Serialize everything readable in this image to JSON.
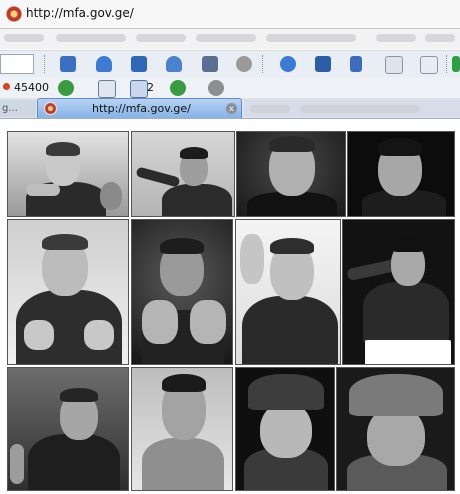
{
  "address_bar": {
    "url": "http://mfa.gov.ge/"
  },
  "toolbar_row": {
    "counter": "45400",
    "mail_count": "2"
  },
  "tabs": {
    "left_tab_label": "g...",
    "active_tab_label": "http://mfa.gov.ge/",
    "close_glyph": "x"
  },
  "icons": [
    "mail-icon",
    "user-icon",
    "home-icon",
    "users-icon",
    "window-icon",
    "settings-icon",
    "help-icon",
    "book-icon",
    "music-icon",
    "document-icon",
    "folder-icon",
    "add-icon",
    "refresh-icon",
    "page-icon",
    "mail-icon",
    "refresh-icon",
    "gear-icon"
  ],
  "colors": {
    "active_tab": "#86b3e6",
    "toolbar": "#e9eef5",
    "counter_dot": "#d9421a"
  },
  "photos": [
    "photo-1",
    "photo-2",
    "photo-3",
    "photo-4",
    "photo-5",
    "photo-6",
    "photo-7",
    "photo-8",
    "photo-9",
    "photo-10",
    "photo-11",
    "photo-12"
  ]
}
